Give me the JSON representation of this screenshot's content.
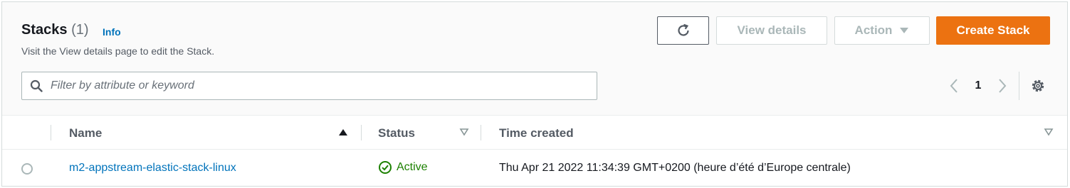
{
  "header": {
    "title": "Stacks",
    "count": "(1)",
    "info_link": "Info",
    "description": "Visit the View details page to edit the Stack."
  },
  "toolbar": {
    "refresh_icon": "refresh-icon",
    "view_details_label": "View details",
    "action_label": "Action",
    "create_label": "Create Stack",
    "create_color": "#ec7211"
  },
  "search": {
    "placeholder": "Filter by attribute or keyword",
    "value": ""
  },
  "pagination": {
    "current_page": "1"
  },
  "table": {
    "columns": [
      {
        "label": "Name",
        "sort": "ascending"
      },
      {
        "label": "Status",
        "sort": "none"
      },
      {
        "label": "Time created",
        "sort": "none"
      }
    ],
    "rows": [
      {
        "selected": false,
        "name": "m2-appstream-elastic-stack-linux",
        "status": "Active",
        "status_color": "#1d8102",
        "time_created": "Thu Apr 21 2022 11:34:39 GMT+0200 (heure d’été d’Europe centrale)"
      }
    ]
  }
}
